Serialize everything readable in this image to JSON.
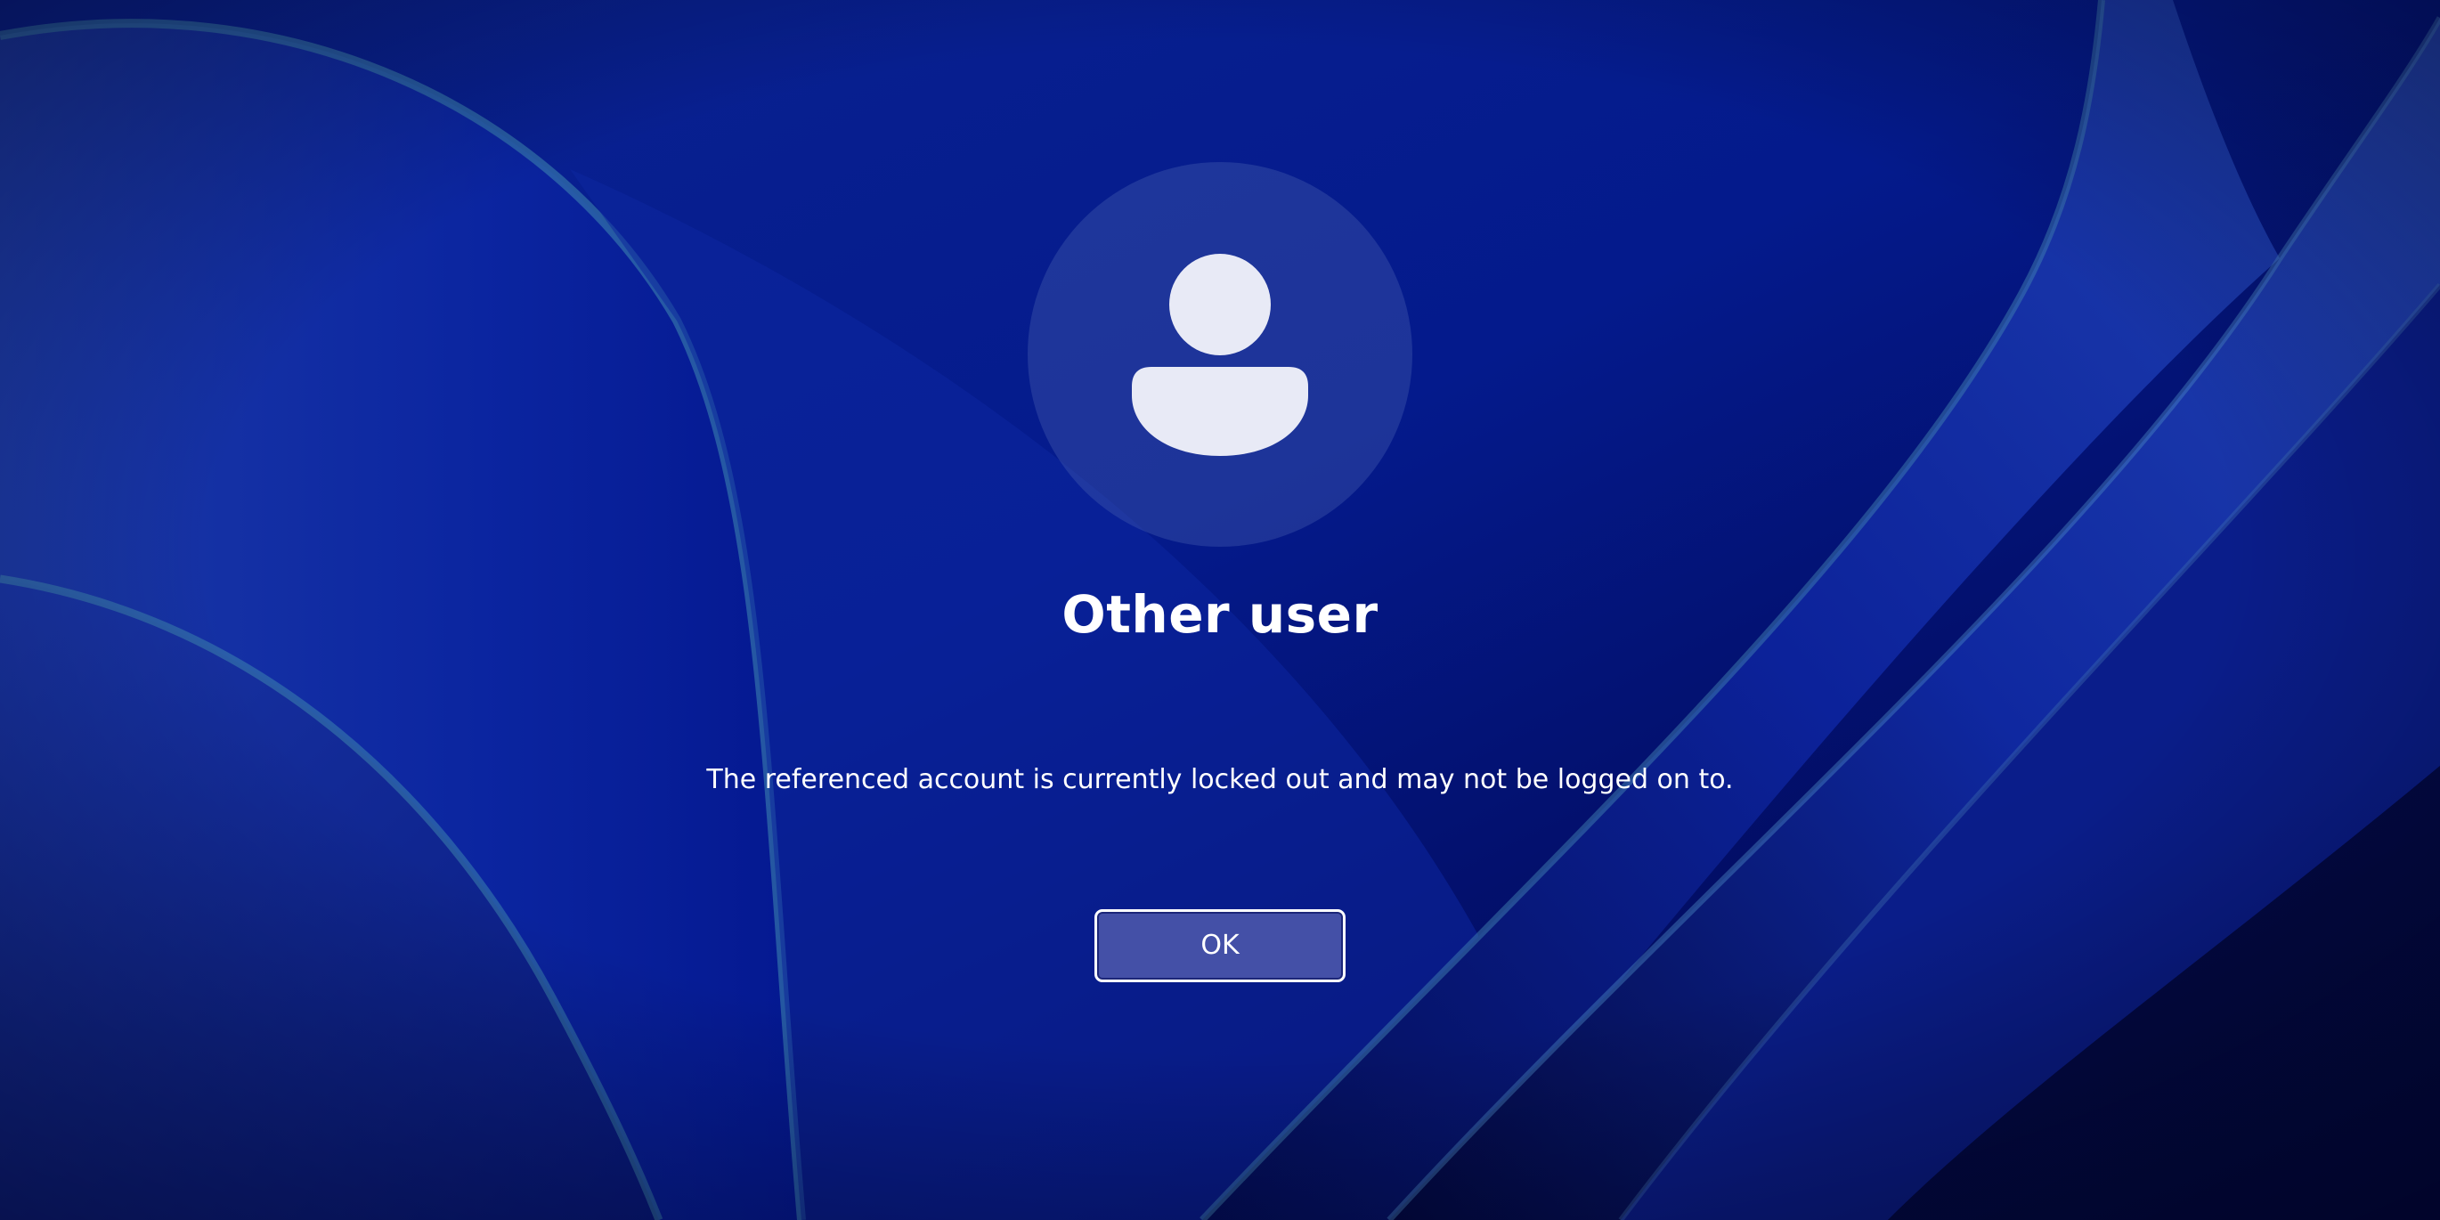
{
  "screen": {
    "type": "sign-in-error",
    "background_color": "#03127a",
    "accent_color": "#4450a7"
  },
  "user": {
    "name": "Other user",
    "avatar_icon": "person-icon"
  },
  "message": {
    "text": "The referenced account is currently locked out and may not be logged on to."
  },
  "buttons": {
    "ok_label": "OK"
  }
}
